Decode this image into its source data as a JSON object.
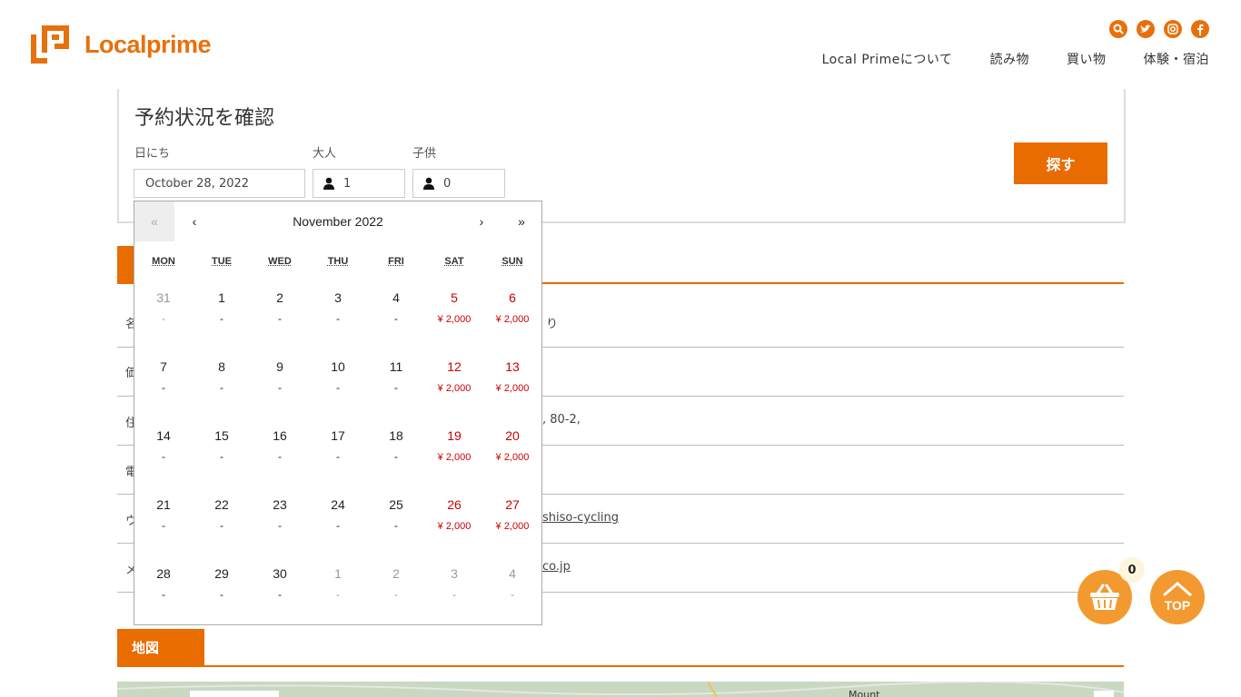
{
  "brand": {
    "name": "Localprime",
    "color": "#e8700a"
  },
  "social": [
    "search-icon",
    "twitter-icon",
    "instagram-icon",
    "facebook-icon"
  ],
  "nav": [
    "Local Primeについて",
    "読み物",
    "買い物",
    "体験・宿泊"
  ],
  "search": {
    "title": "予約状況を確認",
    "date_label": "日にち",
    "date_value": "October 28, 2022",
    "adult_label": "大人",
    "adult_value": "1",
    "child_label": "子供",
    "child_value": "0",
    "button": "探す"
  },
  "details": {
    "rows": [
      {
        "label": "名",
        "value": "り"
      },
      {
        "label": "価",
        "value": ""
      },
      {
        "label": "住",
        "value": ", 80-2,"
      },
      {
        "label": "電",
        "value": ""
      },
      {
        "label": "ウ",
        "value": "shiso-cycling"
      },
      {
        "label": "メ",
        "value": "co.jp"
      }
    ]
  },
  "map_section": {
    "title": "地図",
    "map_label": "Mount"
  },
  "calendar": {
    "month": "November 2022",
    "nav": {
      "first": "«",
      "prev": "‹",
      "next": "›",
      "last": "»"
    },
    "weekdays": [
      "MON",
      "TUE",
      "WED",
      "THU",
      "FRI",
      "SAT",
      "SUN"
    ],
    "weeks": [
      [
        {
          "d": "31",
          "p": "-",
          "off": true
        },
        {
          "d": "1",
          "p": "-"
        },
        {
          "d": "2",
          "p": "-"
        },
        {
          "d": "3",
          "p": "-"
        },
        {
          "d": "4",
          "p": "-"
        },
        {
          "d": "5",
          "p": "¥ 2,000",
          "we": true
        },
        {
          "d": "6",
          "p": "¥ 2,000",
          "we": true
        }
      ],
      [
        {
          "d": "7",
          "p": "-"
        },
        {
          "d": "8",
          "p": "-"
        },
        {
          "d": "9",
          "p": "-"
        },
        {
          "d": "10",
          "p": "-"
        },
        {
          "d": "11",
          "p": "-"
        },
        {
          "d": "12",
          "p": "¥ 2,000",
          "we": true
        },
        {
          "d": "13",
          "p": "¥ 2,000",
          "we": true
        }
      ],
      [
        {
          "d": "14",
          "p": "-"
        },
        {
          "d": "15",
          "p": "-"
        },
        {
          "d": "16",
          "p": "-"
        },
        {
          "d": "17",
          "p": "-"
        },
        {
          "d": "18",
          "p": "-"
        },
        {
          "d": "19",
          "p": "¥ 2,000",
          "we": true
        },
        {
          "d": "20",
          "p": "¥ 2,000",
          "we": true
        }
      ],
      [
        {
          "d": "21",
          "p": "-"
        },
        {
          "d": "22",
          "p": "-"
        },
        {
          "d": "23",
          "p": "-"
        },
        {
          "d": "24",
          "p": "-"
        },
        {
          "d": "25",
          "p": "-"
        },
        {
          "d": "26",
          "p": "¥ 2,000",
          "we": true
        },
        {
          "d": "27",
          "p": "¥ 2,000",
          "we": true
        }
      ],
      [
        {
          "d": "28",
          "p": "-"
        },
        {
          "d": "29",
          "p": "-"
        },
        {
          "d": "30",
          "p": "-"
        },
        {
          "d": "1",
          "p": "-",
          "off": true
        },
        {
          "d": "2",
          "p": "-",
          "off": true
        },
        {
          "d": "3",
          "p": "-",
          "off": true
        },
        {
          "d": "4",
          "p": "-",
          "off": true
        }
      ]
    ]
  },
  "cart": {
    "count": "0"
  },
  "top_button": "TOP"
}
